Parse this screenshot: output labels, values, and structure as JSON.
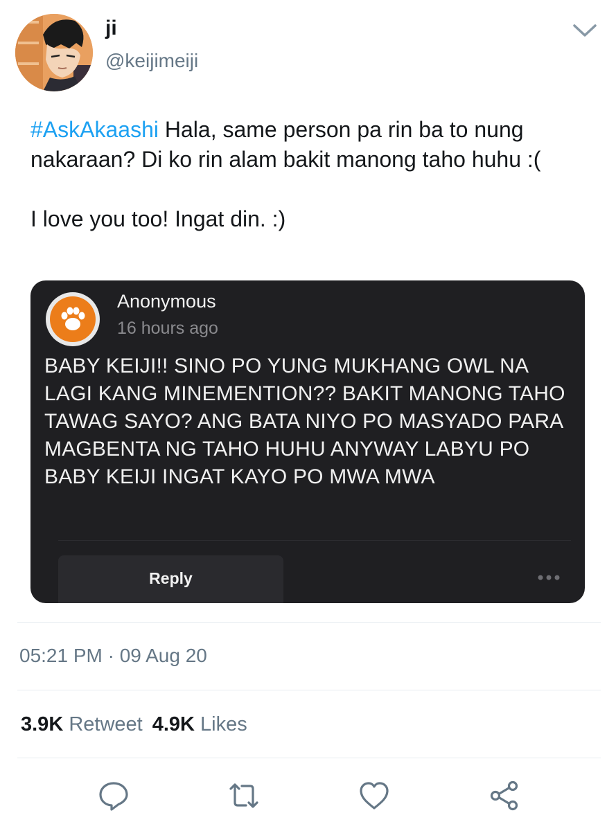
{
  "tweet": {
    "display_name": "ji",
    "handle": "@keijimeiji",
    "hashtag": "#AskAkaashi",
    "text_first": " Hala, same person pa rin ba to nung nakaraan? Di ko rin alam bakit manong taho huhu :(",
    "text_second": "I love you too! Ingat din. :)",
    "timestamp": "05:21 PM · 09 Aug 20",
    "retweet_count": "3.9K",
    "retweet_label": "Retweet",
    "like_count": "4.9K",
    "like_label": "Likes"
  },
  "card": {
    "name": "Anonymous",
    "time": "16 hours ago",
    "question": "BABY KEIJI!! SINO PO YUNG MUKHANG OWL NA LAGI KANG MINEMENTION?? BAKIT MANONG TAHO TAWAG SAYO? ANG BATA NIYO PO MASYADO PARA MAGBENTA NG TAHO HUHU ANYWAY LABYU PO BABY KEIJI INGAT KAYO PO MWA MWA",
    "reply_label": "Reply",
    "avatar_color": "#ec7d1a",
    "background_color": "#1f1f22"
  },
  "colors": {
    "hashtag": "#1da1f2",
    "secondary_text": "#657786"
  },
  "icons": {
    "menu": "chevron-down-icon",
    "paw": "paw-icon",
    "more": "more-dots-icon",
    "reply": "comment-icon",
    "retweet": "retweet-icon",
    "like": "heart-icon",
    "share": "share-icon"
  }
}
